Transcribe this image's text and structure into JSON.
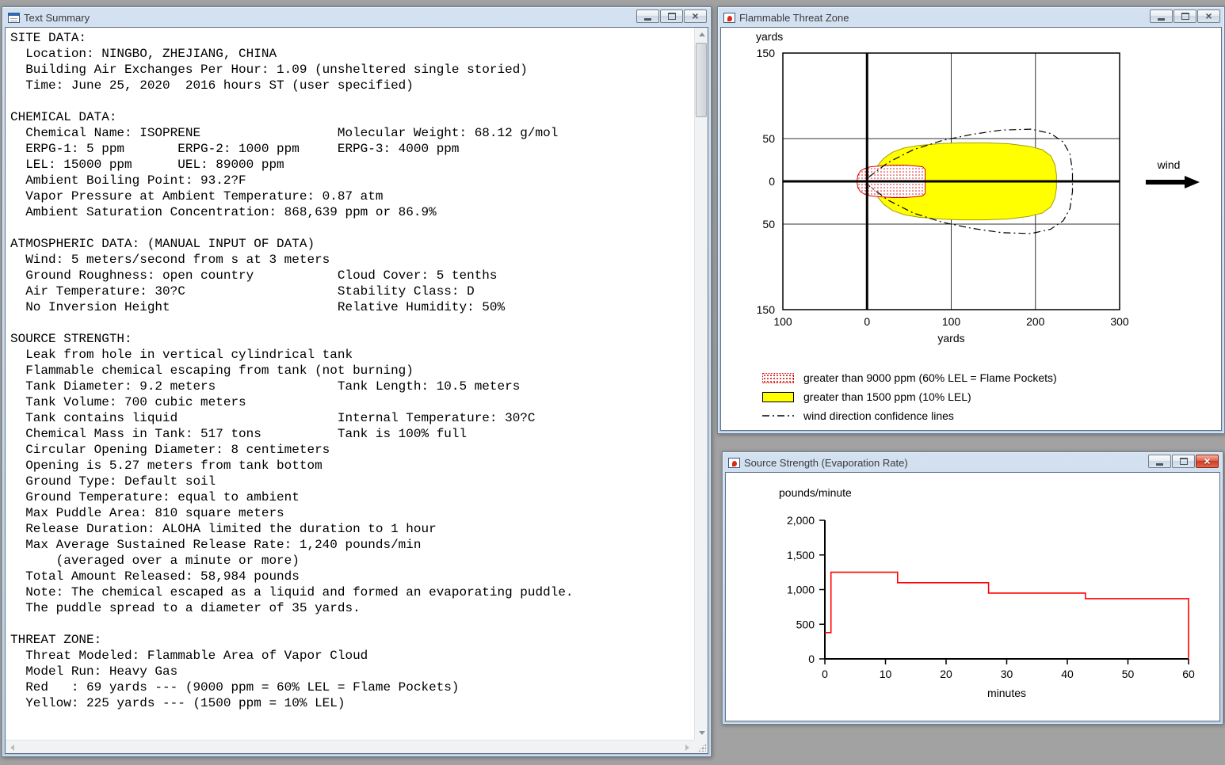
{
  "chrome": {
    "close_glyph": "×"
  },
  "desktop": {
    "background": "#a2a2a2"
  },
  "windows": {
    "text_summary": {
      "title": "Text Summary",
      "content_lines": [
        "SITE DATA:",
        "  Location: NINGBO, ZHEJIANG, CHINA",
        "  Building Air Exchanges Per Hour: 1.09 (unsheltered single storied)",
        "  Time: June 25, 2020  2016 hours ST (user specified)",
        "",
        "CHEMICAL DATA:",
        "  Chemical Name: ISOPRENE                  Molecular Weight: 68.12 g/mol",
        "  ERPG-1: 5 ppm       ERPG-2: 1000 ppm     ERPG-3: 4000 ppm",
        "  LEL: 15000 ppm      UEL: 89000 ppm",
        "  Ambient Boiling Point: 93.2?F",
        "  Vapor Pressure at Ambient Temperature: 0.87 atm",
        "  Ambient Saturation Concentration: 868,639 ppm or 86.9%",
        "",
        "ATMOSPHERIC DATA: (MANUAL INPUT OF DATA)",
        "  Wind: 5 meters/second from s at 3 meters",
        "  Ground Roughness: open country           Cloud Cover: 5 tenths",
        "  Air Temperature: 30?C                    Stability Class: D",
        "  No Inversion Height                      Relative Humidity: 50%",
        "",
        "SOURCE STRENGTH:",
        "  Leak from hole in vertical cylindrical tank",
        "  Flammable chemical escaping from tank (not burning)",
        "  Tank Diameter: 9.2 meters                Tank Length: 10.5 meters",
        "  Tank Volume: 700 cubic meters",
        "  Tank contains liquid                     Internal Temperature: 30?C",
        "  Chemical Mass in Tank: 517 tons          Tank is 100% full",
        "  Circular Opening Diameter: 8 centimeters",
        "  Opening is 5.27 meters from tank bottom",
        "  Ground Type: Default soil",
        "  Ground Temperature: equal to ambient",
        "  Max Puddle Area: 810 square meters",
        "  Release Duration: ALOHA limited the duration to 1 hour",
        "  Max Average Sustained Release Rate: 1,240 pounds/min",
        "      (averaged over a minute or more)",
        "  Total Amount Released: 58,984 pounds",
        "  Note: The chemical escaped as a liquid and formed an evaporating puddle.",
        "  The puddle spread to a diameter of 35 yards.",
        "",
        "THREAT ZONE:",
        "  Threat Modeled: Flammable Area of Vapor Cloud",
        "  Model Run: Heavy Gas",
        "  Red   : 69 yards --- (9000 ppm = 60% LEL = Flame Pockets)",
        "  Yellow: 225 yards --- (1500 ppm = 10% LEL)"
      ]
    },
    "threat_zone": {
      "title": "Flammable Threat Zone",
      "legend": {
        "red_label": "greater than 9000 ppm (60% LEL = Flame Pockets)",
        "yellow_label": "greater than 1500 ppm (10% LEL)",
        "confidence_label": "wind direction confidence lines"
      }
    },
    "source_strength": {
      "title": "Source Strength (Evaporation Rate)"
    }
  },
  "chart_data": [
    {
      "id": "flammable_threat_zone",
      "type": "area",
      "title": "Flammable Threat Zone",
      "xlabel": "yards",
      "ylabel": "yards",
      "wind_label": "wind",
      "xlim": [
        -100,
        300
      ],
      "ylim": [
        -150,
        150
      ],
      "x_ticks": [
        -100,
        0,
        100,
        200,
        300
      ],
      "x_tick_labels": [
        "100",
        "0",
        "100",
        "200",
        "300"
      ],
      "y_ticks": [
        150,
        50,
        0,
        -50,
        -150
      ],
      "y_tick_labels": [
        "150",
        "50",
        "0",
        "50",
        "150"
      ],
      "grid": {
        "x": [
          100,
          200
        ],
        "y": [
          50,
          -50
        ]
      },
      "colors": {
        "yellow": "#ffff00",
        "red": "#dd0000"
      },
      "zones": [
        {
          "name": "yellow",
          "threshold_ppm": 1500,
          "threshold_note": "10% LEL",
          "distance_yards": 225,
          "outline_top": [
            [
              8,
              0
            ],
            [
              9,
              10
            ],
            [
              13,
              19
            ],
            [
              20,
              27
            ],
            [
              30,
              34
            ],
            [
              44,
              39
            ],
            [
              62,
              42
            ],
            [
              85,
              44
            ],
            [
              110,
              45
            ],
            [
              140,
              45
            ],
            [
              168,
              44
            ],
            [
              192,
              41
            ],
            [
              208,
              37
            ],
            [
              218,
              30
            ],
            [
              223,
              20
            ],
            [
              225,
              8
            ],
            [
              225,
              0
            ]
          ]
        },
        {
          "name": "red",
          "threshold_ppm": 9000,
          "threshold_note": "60% LEL = Flame Pockets",
          "distance_yards": 69,
          "outline_top": [
            [
              -12,
              0
            ],
            [
              -11,
              7
            ],
            [
              -8,
              12
            ],
            [
              -3,
              15
            ],
            [
              4,
              17
            ],
            [
              15,
              18
            ],
            [
              30,
              19
            ],
            [
              45,
              19
            ],
            [
              58,
              18
            ],
            [
              66,
              17
            ],
            [
              69,
              14
            ],
            [
              69,
              0
            ]
          ]
        }
      ],
      "confidence_line_top": [
        [
          2,
          5
        ],
        [
          25,
          22
        ],
        [
          55,
          37
        ],
        [
          90,
          48
        ],
        [
          125,
          55
        ],
        [
          160,
          60
        ],
        [
          195,
          61
        ],
        [
          218,
          56
        ],
        [
          233,
          46
        ],
        [
          241,
          32
        ],
        [
          244,
          12
        ],
        [
          244,
          0
        ]
      ]
    },
    {
      "id": "source_strength",
      "type": "line",
      "title": "Source Strength (Evaporation Rate)",
      "xlabel": "minutes",
      "ylabel": "pounds/minute",
      "xlim": [
        0,
        60
      ],
      "ylim": [
        0,
        2000
      ],
      "x_ticks": [
        0,
        10,
        20,
        30,
        40,
        50,
        60
      ],
      "y_ticks": [
        0,
        500,
        1000,
        1500,
        2000
      ],
      "y_tick_labels": [
        "0",
        "500",
        "1,000",
        "1,500",
        "2,000"
      ],
      "line_color": "#ff0000",
      "points": [
        [
          0,
          380
        ],
        [
          1,
          380
        ],
        [
          1,
          1250
        ],
        [
          12,
          1250
        ],
        [
          12,
          1100
        ],
        [
          27,
          1100
        ],
        [
          27,
          950
        ],
        [
          43,
          950
        ],
        [
          43,
          870
        ],
        [
          60,
          870
        ],
        [
          60,
          0
        ]
      ]
    }
  ]
}
